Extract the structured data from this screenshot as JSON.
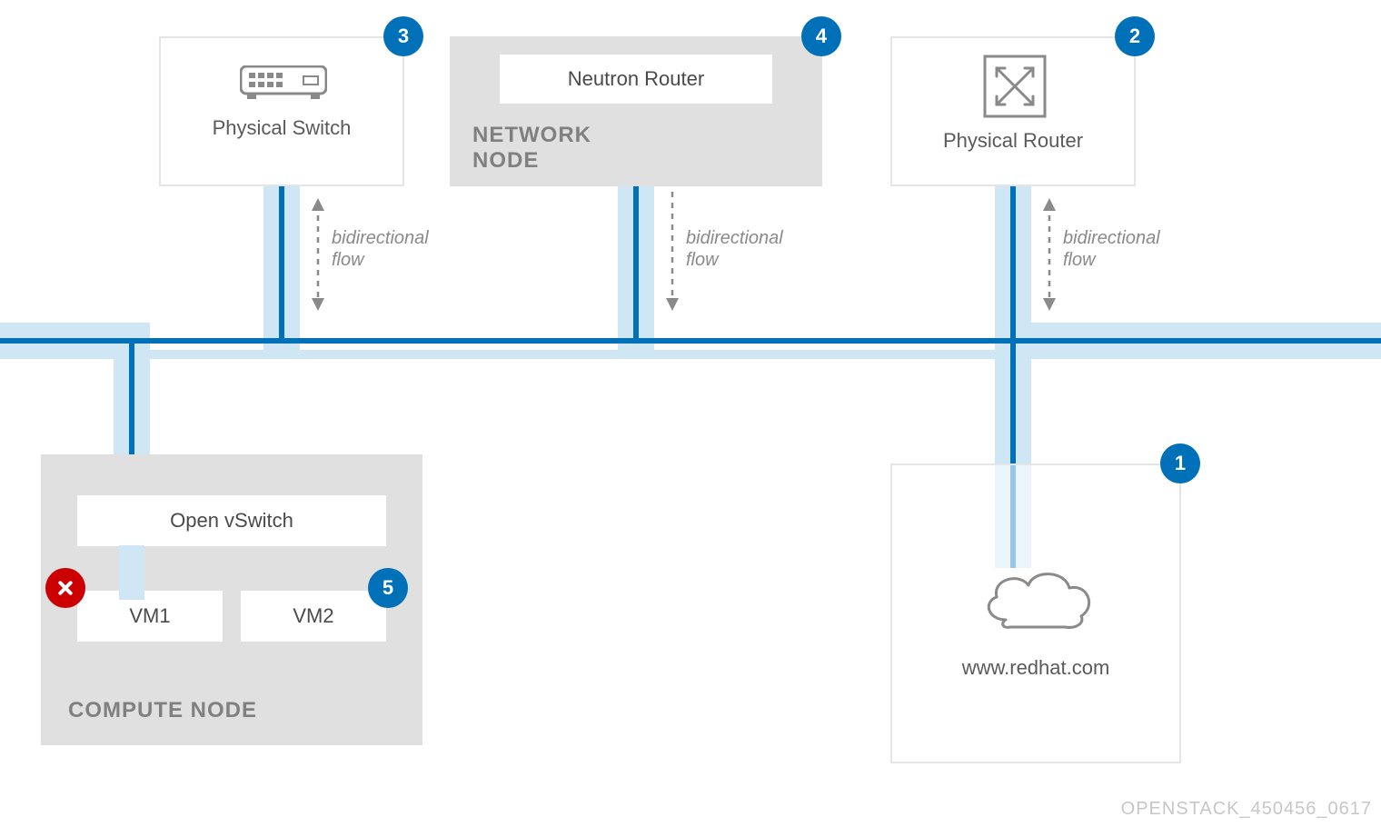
{
  "badges": {
    "b1": "1",
    "b2": "2",
    "b3": "3",
    "b4": "4",
    "b5": "5"
  },
  "switchBox": {
    "label": "Physical Switch"
  },
  "routerBox": {
    "label": "Physical Router"
  },
  "networkNode": {
    "title": "NETWORK NODE",
    "neutron": "Neutron Router"
  },
  "computeNode": {
    "title": "COMPUTE NODE",
    "ovs": "Open vSwitch",
    "vm1": "VM1",
    "vm2": "VM2"
  },
  "internetBox": {
    "label": "www.redhat.com"
  },
  "flow1": {
    "a": "bidirectional",
    "b": "flow"
  },
  "flow2": {
    "a": "bidirectional",
    "b": "flow"
  },
  "flow3": {
    "a": "bidirectional",
    "b": "flow"
  },
  "footer": "OPENSTACK_450456_0617",
  "colors": {
    "pipeFill": "#cfe7f5",
    "pipeStroke": "#0070b8",
    "gray": "#8a8a8a",
    "badgeBlue": "#0070b8",
    "badgeRed": "#cc0000"
  }
}
